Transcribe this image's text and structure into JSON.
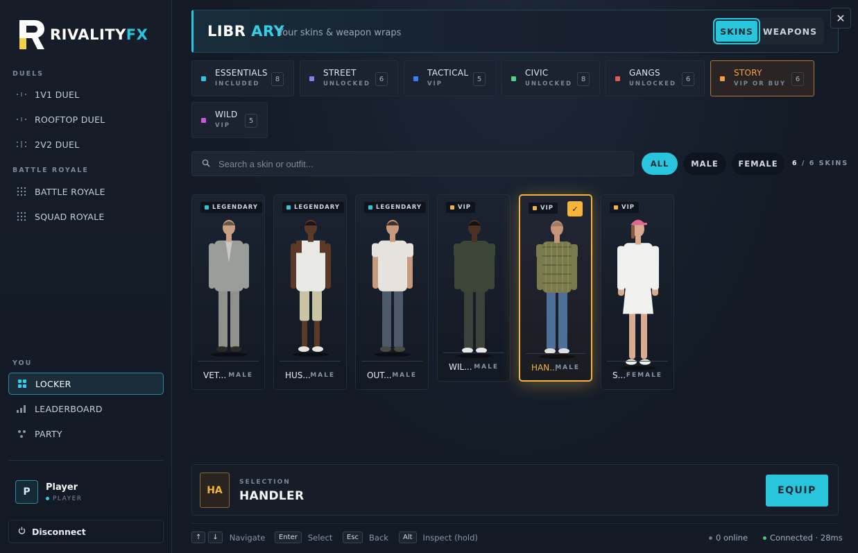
{
  "brand": {
    "name_main": "RIVALITY",
    "name_accent": "FX"
  },
  "sidebar": {
    "sections": [
      {
        "label": "DUELS",
        "items": [
          {
            "label": "1V1 DUEL"
          },
          {
            "label": "ROOFTOP DUEL"
          },
          {
            "label": "2V2 DUEL"
          }
        ]
      },
      {
        "label": "BATTLE ROYALE",
        "items": [
          {
            "label": "BATTLE ROYALE"
          },
          {
            "label": "SQUAD ROYALE"
          }
        ]
      },
      {
        "label": "YOU",
        "items": [
          {
            "label": "LOCKER",
            "active": true
          },
          {
            "label": "LEADERBOARD"
          },
          {
            "label": "PARTY"
          }
        ]
      }
    ],
    "player": {
      "initial": "P",
      "name": "Player",
      "role": "PLAYER"
    },
    "disconnect_label": "Disconnect"
  },
  "header": {
    "title_main": "LIBR",
    "title_accent": "ARY",
    "subtitle": "Your skins & weapon wraps",
    "tabs": [
      {
        "label": "SKINS",
        "active": true
      },
      {
        "label": "WEAPONS"
      }
    ],
    "close_glyph": "✕"
  },
  "categories": [
    {
      "name": "ESSENTIALS",
      "sub": "INCLUDED",
      "count": "8",
      "color": "#2cc6de"
    },
    {
      "name": "STREET",
      "sub": "UNLOCKED",
      "count": "6",
      "color": "#8b7cf0"
    },
    {
      "name": "TACTICAL",
      "sub": "VIP",
      "count": "5",
      "color": "#3c7ef0"
    },
    {
      "name": "CIVIC",
      "sub": "UNLOCKED",
      "count": "8",
      "color": "#4fd08a"
    },
    {
      "name": "GANGS",
      "sub": "UNLOCKED",
      "count": "6",
      "color": "#e45a5a"
    },
    {
      "name": "STORY",
      "sub": "VIP OR BUY",
      "count": "6",
      "color": "#f59a45",
      "selected": true
    },
    {
      "name": "WILD",
      "sub": "VIP",
      "count": "5",
      "color": "#c65ae0"
    }
  ],
  "search": {
    "placeholder": "Search a skin or outfit..."
  },
  "filters": [
    {
      "label": "ALL",
      "active": true
    },
    {
      "label": "MALE"
    },
    {
      "label": "FEMALE"
    }
  ],
  "skin_count": {
    "shown": "6",
    "sep": " / ",
    "total": "6",
    "unit": " SKINS"
  },
  "skins": [
    {
      "name": "VET...",
      "gender": "MALE",
      "tier": "LEGENDARY",
      "tier_color": "#2cc6de",
      "top": "#9a9d98",
      "shirt": "#c9c9c4",
      "legs": "#8e918c",
      "skin": "#c9a083",
      "hair": "#6a5645",
      "shoes": "#2b2a28",
      "outfit": "suit"
    },
    {
      "name": "HUS...",
      "gender": "MALE",
      "tier": "LEGENDARY",
      "tier_color": "#2cc6de",
      "top": "#e9e9e6",
      "shirt": "#e9e9e6",
      "legs": "#c9c4a4",
      "skin": "#5a3a26",
      "hair": "#1e1611",
      "shoes": "#e7e4de",
      "outfit": "tank"
    },
    {
      "name": "OUT...",
      "gender": "MALE",
      "tier": "LEGENDARY",
      "tier_color": "#2cc6de",
      "top": "#e6e3dd",
      "shirt": "#e6e3dd",
      "legs": "#4c5a6a",
      "skin": "#c79a7d",
      "hair": "#3e3125",
      "shoes": "#4a4a44",
      "outfit": "tee"
    },
    {
      "name": "WIL...",
      "gender": "MALE",
      "tier": "VIP",
      "tier_color": "#f3b53a",
      "top": "#3c4636",
      "shirt": "#3c4636",
      "legs": "#3a423a",
      "skin": "#4a3123",
      "hair": "#16110d",
      "shoes": "#e7e7e5",
      "outfit": "shirt"
    },
    {
      "name": "HAN...",
      "gender": "MALE",
      "tier": "VIP",
      "tier_color": "#f3b53a",
      "top": "#7b7a4e",
      "shirt": "#7b7a4e",
      "legs": "#4e6f9a",
      "skin": "#c49479",
      "hair": "#a07a62",
      "shoes": "#e0e0de",
      "outfit": "plaid",
      "selected": true
    },
    {
      "name": "S...",
      "gender": "FEMALE",
      "tier": "VIP",
      "tier_color": "#f3b53a",
      "top": "#f1f1ef",
      "shirt": "#f1f1ef",
      "legs": "#d4a88c",
      "skin": "#d9ab90",
      "hair": "#e0678f",
      "shoes": "#f1f1ef",
      "outfit": "dress"
    }
  ],
  "selection": {
    "thumb": "HA",
    "label": "SELECTION",
    "name": "HANDLER",
    "equip_label": "EQUIP"
  },
  "footer": {
    "hints": [
      {
        "keys": [
          "↑",
          "↓"
        ],
        "label": "Navigate"
      },
      {
        "keys": [
          "Enter"
        ],
        "label": "Select"
      },
      {
        "keys": [
          "Esc"
        ],
        "label": "Back"
      },
      {
        "keys": [
          "Alt"
        ],
        "label": "Inspect (hold)"
      }
    ],
    "online": "0 online",
    "connection": "Connected · 28ms"
  },
  "colors": {
    "accent": "#29c5dc",
    "gold": "#f3b53a",
    "online_dot": "#6f7886",
    "connected_dot": "#3ccf7c"
  }
}
